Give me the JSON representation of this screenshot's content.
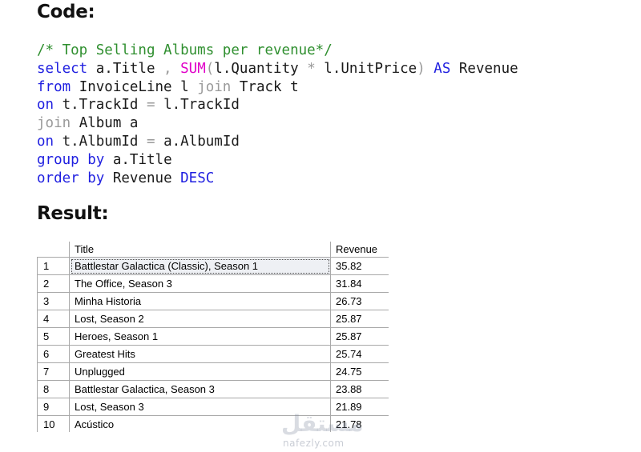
{
  "code_heading": "Code:",
  "result_heading": "Result:",
  "code": {
    "lines": [
      [
        {
          "t": "/* Top Selling Albums per revenue*/",
          "c": "comment"
        }
      ],
      [
        {
          "t": "select",
          "c": "kw"
        },
        {
          "t": " a.Title ",
          "c": "id"
        },
        {
          "t": ",",
          "c": "op"
        },
        {
          "t": " ",
          "c": "id"
        },
        {
          "t": "SUM",
          "c": "fn"
        },
        {
          "t": "(",
          "c": "op"
        },
        {
          "t": "l.Quantity ",
          "c": "id"
        },
        {
          "t": "*",
          "c": "op"
        },
        {
          "t": " l.UnitPrice",
          "c": "id"
        },
        {
          "t": ")",
          "c": "op"
        },
        {
          "t": " ",
          "c": "id"
        },
        {
          "t": "AS",
          "c": "kw"
        },
        {
          "t": " Revenue",
          "c": "id"
        }
      ],
      [
        {
          "t": "from",
          "c": "kw"
        },
        {
          "t": " InvoiceLine l ",
          "c": "id"
        },
        {
          "t": "join",
          "c": "op"
        },
        {
          "t": " Track t",
          "c": "id"
        }
      ],
      [
        {
          "t": "on",
          "c": "kw"
        },
        {
          "t": " t.TrackId ",
          "c": "id"
        },
        {
          "t": "=",
          "c": "op"
        },
        {
          "t": " l.TrackId",
          "c": "id"
        }
      ],
      [
        {
          "t": "join",
          "c": "op"
        },
        {
          "t": " Album a",
          "c": "id"
        }
      ],
      [
        {
          "t": "on",
          "c": "kw"
        },
        {
          "t": " t.AlbumId ",
          "c": "id"
        },
        {
          "t": "=",
          "c": "op"
        },
        {
          "t": " a.AlbumId",
          "c": "id"
        }
      ],
      [
        {
          "t": "group",
          "c": "kw"
        },
        {
          "t": " ",
          "c": "id"
        },
        {
          "t": "by",
          "c": "kw"
        },
        {
          "t": " a.Title",
          "c": "id"
        }
      ],
      [
        {
          "t": "order",
          "c": "kw"
        },
        {
          "t": " ",
          "c": "id"
        },
        {
          "t": "by",
          "c": "kw"
        },
        {
          "t": " Revenue ",
          "c": "id"
        },
        {
          "t": "DESC",
          "c": "kw"
        }
      ]
    ]
  },
  "results": {
    "columns": [
      "",
      "Title",
      "Revenue"
    ],
    "selected_row": 0,
    "rows": [
      {
        "num": "1",
        "title": "Battlestar Galactica (Classic), Season 1",
        "revenue": "35.82"
      },
      {
        "num": "2",
        "title": "The Office, Season 3",
        "revenue": "31.84"
      },
      {
        "num": "3",
        "title": "Minha Historia",
        "revenue": "26.73"
      },
      {
        "num": "4",
        "title": "Lost, Season 2",
        "revenue": "25.87"
      },
      {
        "num": "5",
        "title": "Heroes, Season 1",
        "revenue": "25.87"
      },
      {
        "num": "6",
        "title": "Greatest Hits",
        "revenue": "25.74"
      },
      {
        "num": "7",
        "title": "Unplugged",
        "revenue": "24.75"
      },
      {
        "num": "8",
        "title": "Battlestar Galactica, Season 3",
        "revenue": "23.88"
      },
      {
        "num": "9",
        "title": "Lost, Season 3",
        "revenue": "21.89"
      },
      {
        "num": "10",
        "title": "Acústico",
        "revenue": "21.78"
      }
    ]
  },
  "watermark": {
    "arabic": "مستقل",
    "latin": "nafezly.com"
  }
}
